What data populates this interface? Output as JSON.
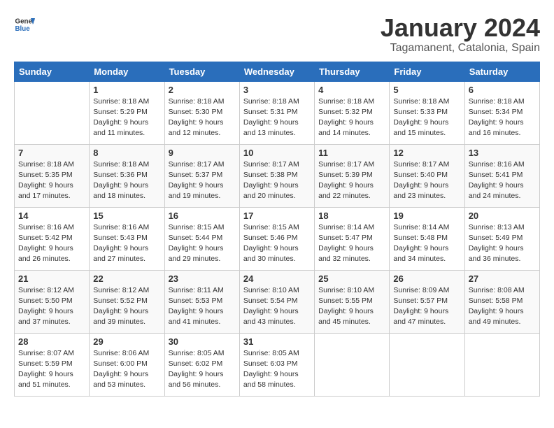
{
  "logo": {
    "general": "General",
    "blue": "Blue"
  },
  "title": "January 2024",
  "subtitle": "Tagamanent, Catalonia, Spain",
  "days_of_week": [
    "Sunday",
    "Monday",
    "Tuesday",
    "Wednesday",
    "Thursday",
    "Friday",
    "Saturday"
  ],
  "weeks": [
    [
      {
        "day": "",
        "info": ""
      },
      {
        "day": "1",
        "info": "Sunrise: 8:18 AM\nSunset: 5:29 PM\nDaylight: 9 hours\nand 11 minutes."
      },
      {
        "day": "2",
        "info": "Sunrise: 8:18 AM\nSunset: 5:30 PM\nDaylight: 9 hours\nand 12 minutes."
      },
      {
        "day": "3",
        "info": "Sunrise: 8:18 AM\nSunset: 5:31 PM\nDaylight: 9 hours\nand 13 minutes."
      },
      {
        "day": "4",
        "info": "Sunrise: 8:18 AM\nSunset: 5:32 PM\nDaylight: 9 hours\nand 14 minutes."
      },
      {
        "day": "5",
        "info": "Sunrise: 8:18 AM\nSunset: 5:33 PM\nDaylight: 9 hours\nand 15 minutes."
      },
      {
        "day": "6",
        "info": "Sunrise: 8:18 AM\nSunset: 5:34 PM\nDaylight: 9 hours\nand 16 minutes."
      }
    ],
    [
      {
        "day": "7",
        "info": "Sunrise: 8:18 AM\nSunset: 5:35 PM\nDaylight: 9 hours\nand 17 minutes."
      },
      {
        "day": "8",
        "info": "Sunrise: 8:18 AM\nSunset: 5:36 PM\nDaylight: 9 hours\nand 18 minutes."
      },
      {
        "day": "9",
        "info": "Sunrise: 8:17 AM\nSunset: 5:37 PM\nDaylight: 9 hours\nand 19 minutes."
      },
      {
        "day": "10",
        "info": "Sunrise: 8:17 AM\nSunset: 5:38 PM\nDaylight: 9 hours\nand 20 minutes."
      },
      {
        "day": "11",
        "info": "Sunrise: 8:17 AM\nSunset: 5:39 PM\nDaylight: 9 hours\nand 22 minutes."
      },
      {
        "day": "12",
        "info": "Sunrise: 8:17 AM\nSunset: 5:40 PM\nDaylight: 9 hours\nand 23 minutes."
      },
      {
        "day": "13",
        "info": "Sunrise: 8:16 AM\nSunset: 5:41 PM\nDaylight: 9 hours\nand 24 minutes."
      }
    ],
    [
      {
        "day": "14",
        "info": "Sunrise: 8:16 AM\nSunset: 5:42 PM\nDaylight: 9 hours\nand 26 minutes."
      },
      {
        "day": "15",
        "info": "Sunrise: 8:16 AM\nSunset: 5:43 PM\nDaylight: 9 hours\nand 27 minutes."
      },
      {
        "day": "16",
        "info": "Sunrise: 8:15 AM\nSunset: 5:44 PM\nDaylight: 9 hours\nand 29 minutes."
      },
      {
        "day": "17",
        "info": "Sunrise: 8:15 AM\nSunset: 5:46 PM\nDaylight: 9 hours\nand 30 minutes."
      },
      {
        "day": "18",
        "info": "Sunrise: 8:14 AM\nSunset: 5:47 PM\nDaylight: 9 hours\nand 32 minutes."
      },
      {
        "day": "19",
        "info": "Sunrise: 8:14 AM\nSunset: 5:48 PM\nDaylight: 9 hours\nand 34 minutes."
      },
      {
        "day": "20",
        "info": "Sunrise: 8:13 AM\nSunset: 5:49 PM\nDaylight: 9 hours\nand 36 minutes."
      }
    ],
    [
      {
        "day": "21",
        "info": "Sunrise: 8:12 AM\nSunset: 5:50 PM\nDaylight: 9 hours\nand 37 minutes."
      },
      {
        "day": "22",
        "info": "Sunrise: 8:12 AM\nSunset: 5:52 PM\nDaylight: 9 hours\nand 39 minutes."
      },
      {
        "day": "23",
        "info": "Sunrise: 8:11 AM\nSunset: 5:53 PM\nDaylight: 9 hours\nand 41 minutes."
      },
      {
        "day": "24",
        "info": "Sunrise: 8:10 AM\nSunset: 5:54 PM\nDaylight: 9 hours\nand 43 minutes."
      },
      {
        "day": "25",
        "info": "Sunrise: 8:10 AM\nSunset: 5:55 PM\nDaylight: 9 hours\nand 45 minutes."
      },
      {
        "day": "26",
        "info": "Sunrise: 8:09 AM\nSunset: 5:57 PM\nDaylight: 9 hours\nand 47 minutes."
      },
      {
        "day": "27",
        "info": "Sunrise: 8:08 AM\nSunset: 5:58 PM\nDaylight: 9 hours\nand 49 minutes."
      }
    ],
    [
      {
        "day": "28",
        "info": "Sunrise: 8:07 AM\nSunset: 5:59 PM\nDaylight: 9 hours\nand 51 minutes."
      },
      {
        "day": "29",
        "info": "Sunrise: 8:06 AM\nSunset: 6:00 PM\nDaylight: 9 hours\nand 53 minutes."
      },
      {
        "day": "30",
        "info": "Sunrise: 8:05 AM\nSunset: 6:02 PM\nDaylight: 9 hours\nand 56 minutes."
      },
      {
        "day": "31",
        "info": "Sunrise: 8:05 AM\nSunset: 6:03 PM\nDaylight: 9 hours\nand 58 minutes."
      },
      {
        "day": "",
        "info": ""
      },
      {
        "day": "",
        "info": ""
      },
      {
        "day": "",
        "info": ""
      }
    ]
  ]
}
